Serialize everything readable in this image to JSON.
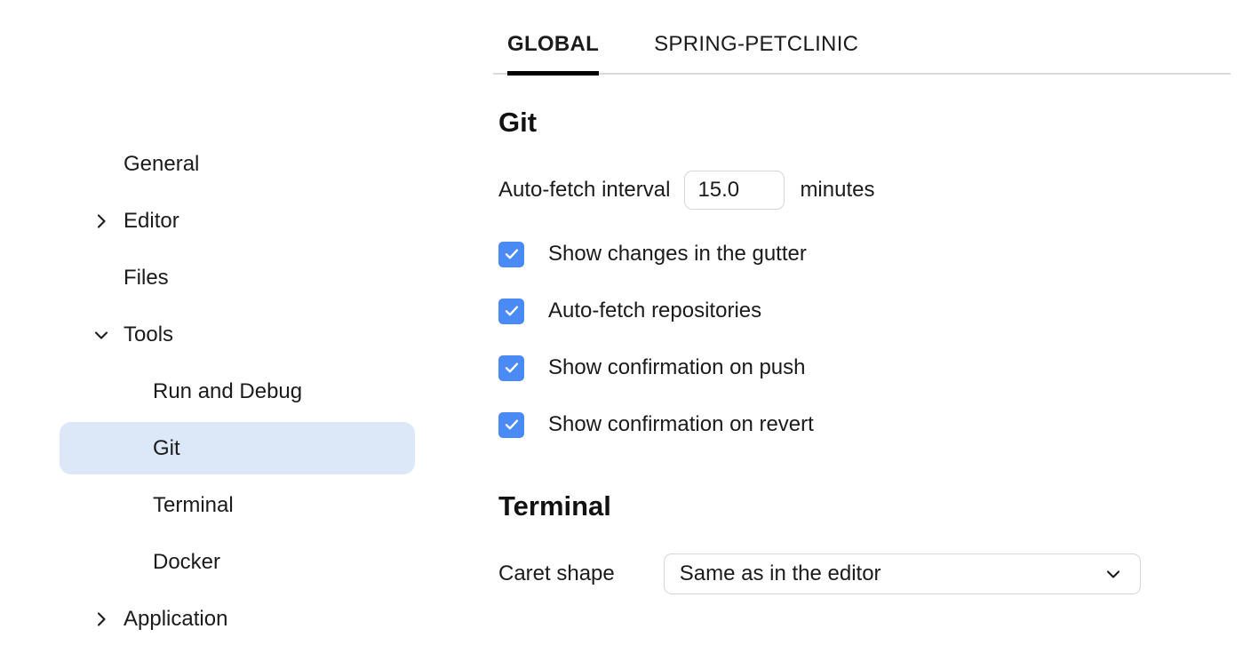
{
  "sidebar": {
    "items": [
      {
        "label": "General",
        "level": 0,
        "chevron": "none",
        "selected": false
      },
      {
        "label": "Editor",
        "level": 0,
        "chevron": "right",
        "selected": false
      },
      {
        "label": "Files",
        "level": 0,
        "chevron": "none",
        "selected": false
      },
      {
        "label": "Tools",
        "level": 0,
        "chevron": "down",
        "selected": false
      },
      {
        "label": "Run and Debug",
        "level": 1,
        "chevron": "none",
        "selected": false
      },
      {
        "label": "Git",
        "level": 1,
        "chevron": "none",
        "selected": true
      },
      {
        "label": "Terminal",
        "level": 1,
        "chevron": "none",
        "selected": false
      },
      {
        "label": "Docker",
        "level": 1,
        "chevron": "none",
        "selected": false
      },
      {
        "label": "Application",
        "level": 0,
        "chevron": "right",
        "selected": false
      }
    ]
  },
  "tabs": [
    {
      "label": "GLOBAL",
      "active": true
    },
    {
      "label": "SPRING-PETCLINIC",
      "active": false
    }
  ],
  "git": {
    "heading": "Git",
    "interval": {
      "label": "Auto-fetch interval",
      "value": "15.0",
      "placeholder": "15.0",
      "unit": "minutes"
    },
    "checkboxes": [
      {
        "label": "Show changes in the gutter",
        "checked": true
      },
      {
        "label": "Auto-fetch repositories",
        "checked": true
      },
      {
        "label": "Show confirmation on push",
        "checked": true
      },
      {
        "label": "Show confirmation on revert",
        "checked": true
      }
    ]
  },
  "terminal": {
    "heading": "Terminal",
    "caret_shape": {
      "label": "Caret shape",
      "value": "Same as in the editor"
    }
  },
  "colors": {
    "accent_blue": "#4a8af4",
    "selection_blue": "#dce7f7",
    "border_gray": "#d6d6d6",
    "divider_gray": "#d9d9d9",
    "text": "#1b1b1b"
  }
}
